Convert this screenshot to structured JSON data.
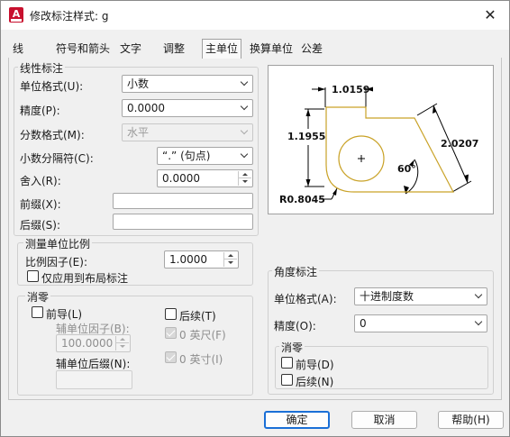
{
  "window": {
    "title": "修改标注样式: g",
    "app_icon": "autocad-app-icon"
  },
  "tabs": [
    "线",
    "符号和箭头",
    "文字",
    "调整",
    "主单位",
    "换算单位",
    "公差"
  ],
  "active_tab": "主单位",
  "linear": {
    "group_label": "线性标注",
    "unit_format_label": "单位格式(U):",
    "unit_format_value": "小数",
    "precision_label": "精度(P):",
    "precision_value": "0.0000",
    "fraction_format_label": "分数格式(M):",
    "fraction_format_value": "水平",
    "decimal_separator_label": "小数分隔符(C):",
    "decimal_separator_value": "“.” (句点)",
    "round_off_label": "舍入(R):",
    "round_off_value": "0.0000",
    "prefix_label": "前缀(X):",
    "prefix_value": "",
    "suffix_label": "后缀(S):",
    "suffix_value": ""
  },
  "scale": {
    "group_label": "测量单位比例",
    "factor_label": "比例因子(E):",
    "factor_value": "1.0000",
    "layout_only_label": "仅应用到布局标注",
    "layout_only_checked": false
  },
  "zero_suppression": {
    "group_label": "消零",
    "leading_label": "前导(L)",
    "leading_checked": false,
    "sub_unit_factor_label": "辅单位因子(B):",
    "sub_unit_factor_value": "100.0000",
    "sub_unit_suffix_label": "辅单位后缀(N):",
    "sub_unit_suffix_value": "",
    "trailing_label": "后续(T)",
    "trailing_checked": false,
    "feet_label": "0 英尺(F)",
    "feet_checked": true,
    "inches_label": "0 英寸(I)",
    "inches_checked": true
  },
  "preview": {
    "dim_top": "1.0159",
    "dim_left": "1.1955",
    "dim_right": "2.0207",
    "angle": "60°",
    "radius": "R0.8045",
    "shape_color": "#c9a227"
  },
  "angular": {
    "group_label": "角度标注",
    "unit_format_label": "单位格式(A):",
    "unit_format_value": "十进制度数",
    "precision_label": "精度(O):",
    "precision_value": "0",
    "zero_group_label": "消零",
    "leading_label": "前导(D)",
    "leading_checked": false,
    "trailing_label": "后续(N)",
    "trailing_checked": false
  },
  "buttons": {
    "ok": "确定",
    "cancel": "取消",
    "help": "帮助(H)"
  },
  "colors": {
    "accent": "#1a6fd6",
    "app_red": "#c8102e"
  }
}
